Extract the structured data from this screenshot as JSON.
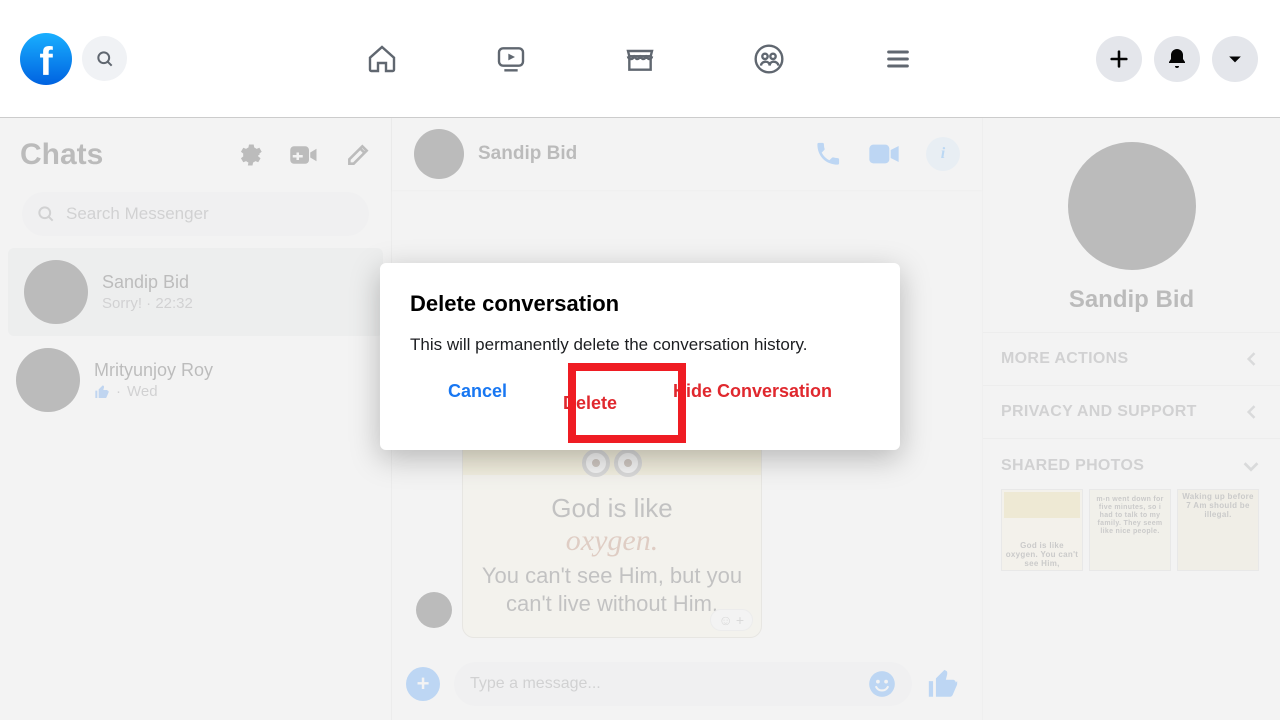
{
  "sidebar": {
    "title": "Chats",
    "search_placeholder": "Search Messenger",
    "items": [
      {
        "name": "Sandip Bid",
        "sub": "Sorry! · 22:32"
      },
      {
        "name": "Mrityunjoy Roy",
        "sub": "Wed"
      }
    ]
  },
  "conversation": {
    "name": "Sandip Bid",
    "image_message": {
      "line1": "God is like",
      "line2": "oxygen.",
      "line3": "You can't see Him, but you can't live without Him."
    },
    "compose_placeholder": "Type a message..."
  },
  "info_panel": {
    "name": "Sandip Bid",
    "sections": {
      "more_actions": "MORE ACTIONS",
      "privacy": "PRIVACY AND SUPPORT",
      "shared_photos": "SHARED PHOTOS"
    },
    "thumbs": [
      "God is like oxygen. You can't see Him,",
      "m-n went down for five minutes, so i had to talk to my family. They seem like nice people.",
      "Waking up before 7 Am should be illegal."
    ]
  },
  "modal": {
    "title": "Delete conversation",
    "body": "This will permanently delete the conversation history.",
    "cancel": "Cancel",
    "delete": "Delete",
    "hide": "Hide Conversation"
  }
}
